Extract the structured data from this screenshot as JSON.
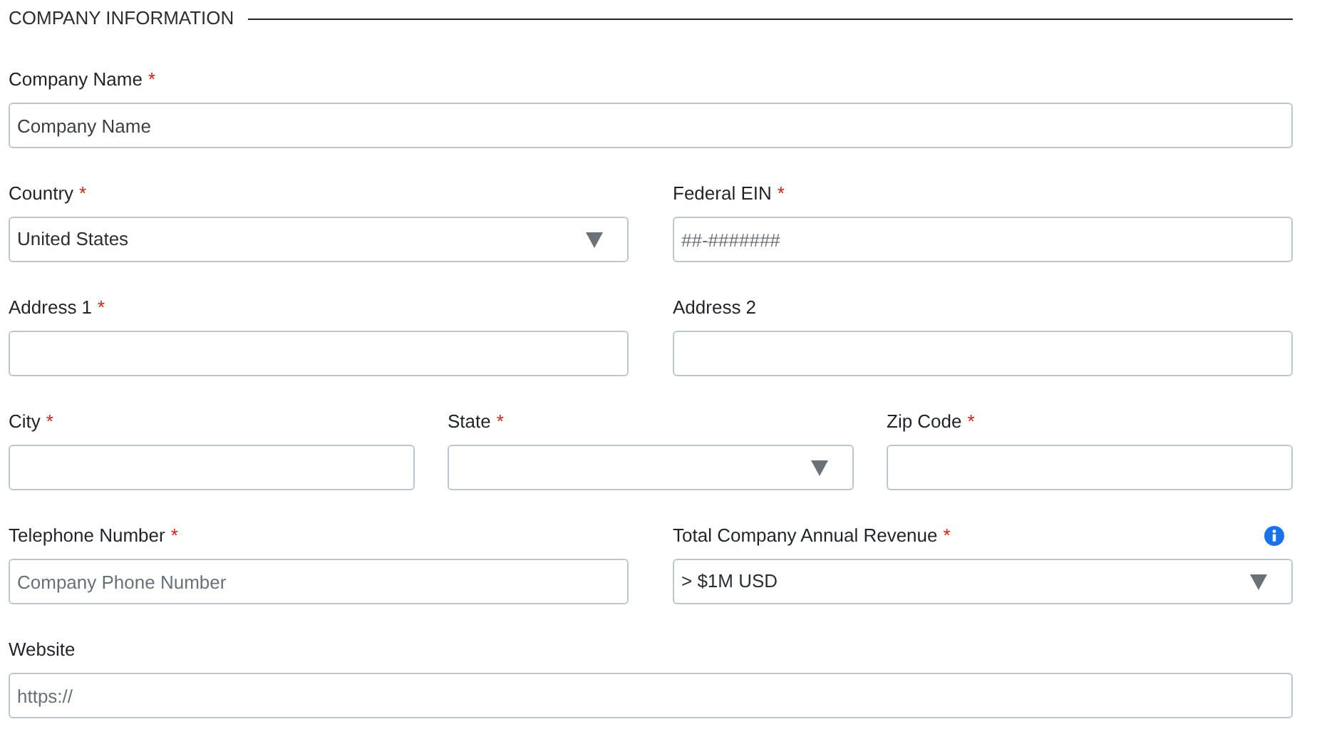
{
  "section_title": "COMPANY INFORMATION",
  "rows": [
    {
      "fields": [
        {
          "kind": "text",
          "label": "Company Name",
          "required_mark": "*",
          "value": "Company Name"
        }
      ]
    },
    {
      "fields": [
        {
          "kind": "select",
          "label": "Country",
          "required_mark": "*",
          "value": "United States"
        },
        {
          "kind": "text",
          "label": "Federal EIN",
          "required_mark": "*",
          "placeholder": "##-#######"
        }
      ]
    },
    {
      "fields": [
        {
          "kind": "text",
          "label": "Address 1",
          "required_mark": "*"
        },
        {
          "kind": "text",
          "label": "Address 2"
        }
      ]
    },
    {
      "fields": [
        {
          "kind": "text",
          "label": "City",
          "required_mark": "*"
        },
        {
          "kind": "select",
          "label": "State",
          "required_mark": "*"
        },
        {
          "kind": "text",
          "label": "Zip Code",
          "required_mark": "*"
        }
      ]
    },
    {
      "fields": [
        {
          "kind": "text",
          "label": "Telephone Number",
          "required_mark": "*",
          "placeholder": "Company Phone Number"
        },
        {
          "kind": "select",
          "label": "Total Company Annual Revenue",
          "required_mark": "*",
          "value": "> $1M USD",
          "info": true
        }
      ]
    },
    {
      "fields": [
        {
          "kind": "text",
          "label": "Website",
          "placeholder": "https://"
        }
      ]
    }
  ]
}
